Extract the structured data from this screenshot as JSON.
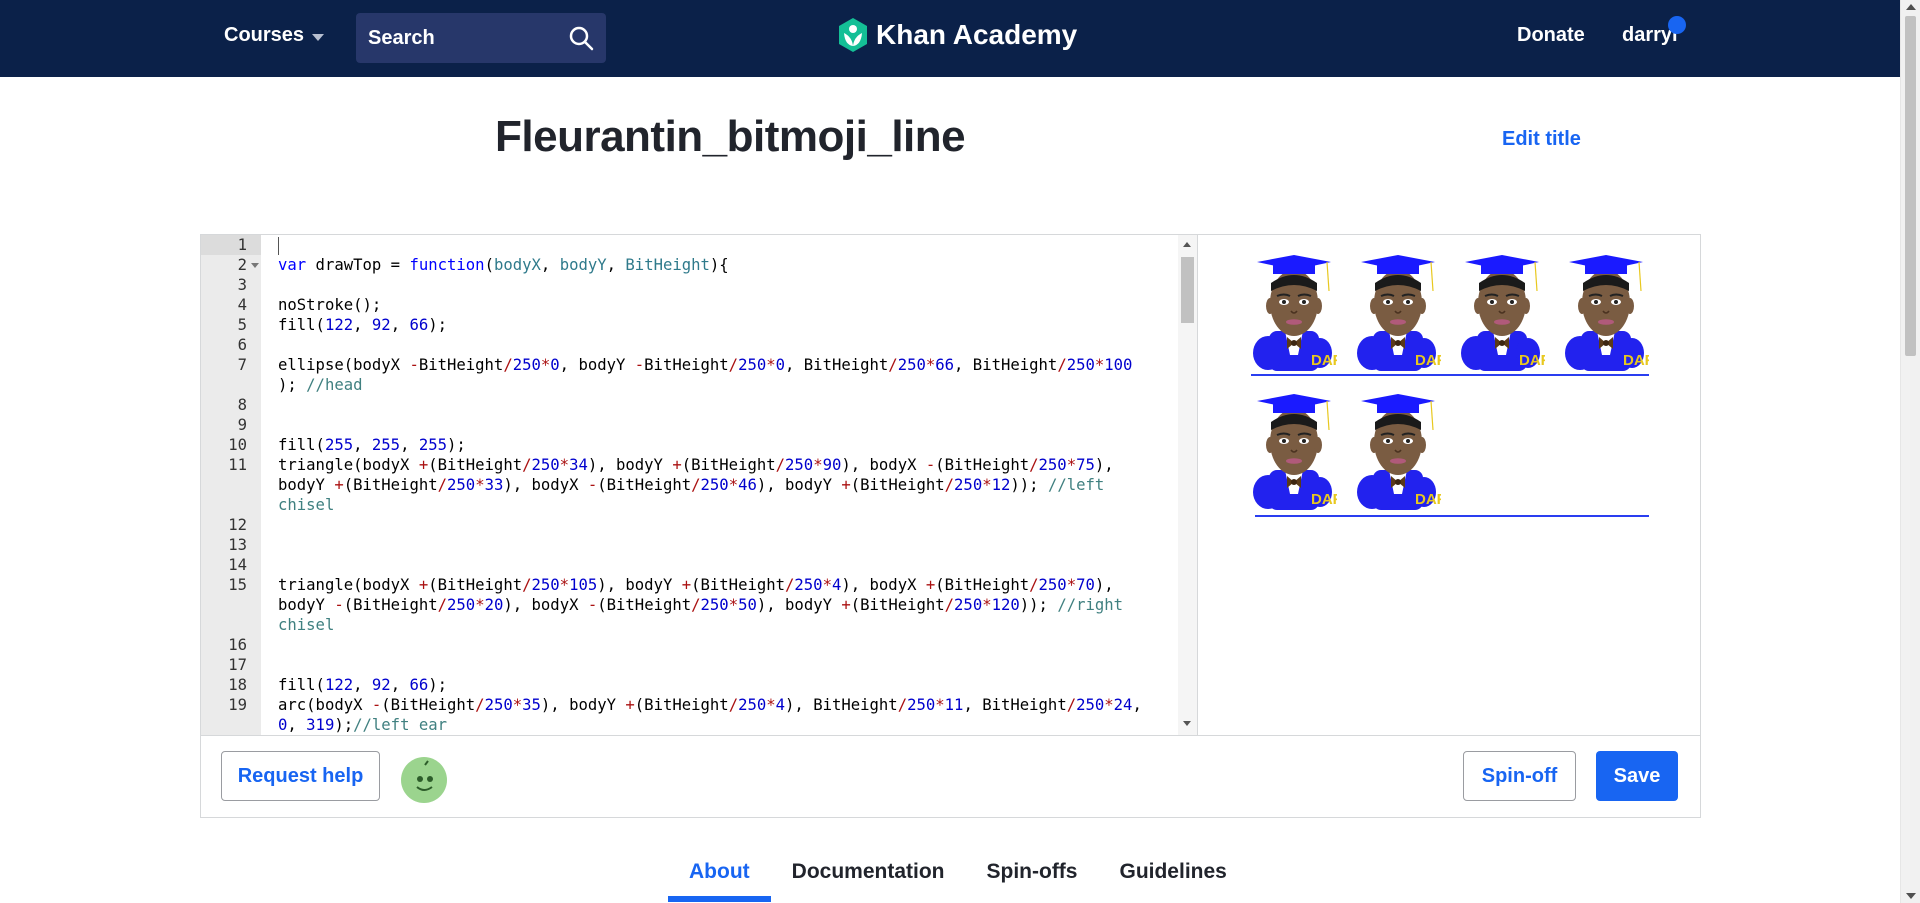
{
  "header": {
    "courses_label": "Courses",
    "search_placeholder": "Search",
    "logo_text": "Khan Academy",
    "donate_label": "Donate",
    "user_name": "darryl",
    "background_color": "#0b2149"
  },
  "page": {
    "title": "Fleurantin_bitmoji_line",
    "edit_title_label": "Edit title"
  },
  "editor": {
    "active_line": 1,
    "lines": [
      {
        "num": "1",
        "html": "<span class=\"cursor\"></span>"
      },
      {
        "num": "2",
        "fold": true,
        "html": "<span class=\"k\">var</span> drawTop = <span class=\"k\">function</span>(<span class=\"p\">bodyX</span>, <span class=\"p\">bodyY</span>, <span class=\"p\">BitHeight</span>){"
      },
      {
        "num": "3",
        "html": ""
      },
      {
        "num": "4",
        "html": "noStroke();"
      },
      {
        "num": "5",
        "html": "fill(<span class=\"n\">122</span>, <span class=\"n\">92</span>, <span class=\"n\">66</span>);"
      },
      {
        "num": "6",
        "html": ""
      },
      {
        "num": "7",
        "html": "ellipse(bodyX <span class=\"o\">-</span>BitHeight<span class=\"o\">/</span><span class=\"n\">250</span><span class=\"o\">*</span><span class=\"n\">0</span>, bodyY <span class=\"o\">-</span>BitHeight<span class=\"o\">/</span><span class=\"n\">250</span><span class=\"o\">*</span><span class=\"n\">0</span>, BitHeight<span class=\"o\">/</span><span class=\"n\">250</span><span class=\"o\">*</span><span class=\"n\">66</span>, BitHeight<span class=\"o\">/</span><span class=\"n\">250</span><span class=\"o\">*</span><span class=\"n\">100</span>\n); <span class=\"c\">//head</span>"
      },
      {
        "num": "8",
        "html": ""
      },
      {
        "num": "9",
        "html": ""
      },
      {
        "num": "10",
        "html": "fill(<span class=\"n\">255</span>, <span class=\"n\">255</span>, <span class=\"n\">255</span>);"
      },
      {
        "num": "11",
        "html": "triangle(bodyX <span class=\"o\">+</span>(BitHeight<span class=\"o\">/</span><span class=\"n\">250</span><span class=\"o\">*</span><span class=\"n\">34</span>), bodyY <span class=\"o\">+</span>(BitHeight<span class=\"o\">/</span><span class=\"n\">250</span><span class=\"o\">*</span><span class=\"n\">90</span>), bodyX <span class=\"o\">-</span>(BitHeight<span class=\"o\">/</span><span class=\"n\">250</span><span class=\"o\">*</span><span class=\"n\">75</span>),\nbodyY <span class=\"o\">+</span>(BitHeight<span class=\"o\">/</span><span class=\"n\">250</span><span class=\"o\">*</span><span class=\"n\">33</span>), bodyX <span class=\"o\">-</span>(BitHeight<span class=\"o\">/</span><span class=\"n\">250</span><span class=\"o\">*</span><span class=\"n\">46</span>), bodyY <span class=\"o\">+</span>(BitHeight<span class=\"o\">/</span><span class=\"n\">250</span><span class=\"o\">*</span><span class=\"n\">12</span>)); <span class=\"c\">//left\nchisel</span>"
      },
      {
        "num": "12",
        "html": ""
      },
      {
        "num": "13",
        "html": ""
      },
      {
        "num": "14",
        "html": ""
      },
      {
        "num": "15",
        "html": "triangle(bodyX <span class=\"o\">+</span>(BitHeight<span class=\"o\">/</span><span class=\"n\">250</span><span class=\"o\">*</span><span class=\"n\">105</span>), bodyY <span class=\"o\">+</span>(BitHeight<span class=\"o\">/</span><span class=\"n\">250</span><span class=\"o\">*</span><span class=\"n\">4</span>), bodyX <span class=\"o\">+</span>(BitHeight<span class=\"o\">/</span><span class=\"n\">250</span><span class=\"o\">*</span><span class=\"n\">70</span>),\nbodyY <span class=\"o\">-</span>(BitHeight<span class=\"o\">/</span><span class=\"n\">250</span><span class=\"o\">*</span><span class=\"n\">20</span>), bodyX <span class=\"o\">-</span>(BitHeight<span class=\"o\">/</span><span class=\"n\">250</span><span class=\"o\">*</span><span class=\"n\">50</span>), bodyY <span class=\"o\">+</span>(BitHeight<span class=\"o\">/</span><span class=\"n\">250</span><span class=\"o\">*</span><span class=\"n\">120</span>)); <span class=\"c\">//right\nchisel</span>"
      },
      {
        "num": "16",
        "html": ""
      },
      {
        "num": "17",
        "html": ""
      },
      {
        "num": "18",
        "html": "fill(<span class=\"n\">122</span>, <span class=\"n\">92</span>, <span class=\"n\">66</span>);"
      },
      {
        "num": "19",
        "html": "arc(bodyX <span class=\"o\">-</span>(BitHeight<span class=\"o\">/</span><span class=\"n\">250</span><span class=\"o\">*</span><span class=\"n\">35</span>), bodyY <span class=\"o\">+</span>(BitHeight<span class=\"o\">/</span><span class=\"n\">250</span><span class=\"o\">*</span><span class=\"n\">4</span>), BitHeight<span class=\"o\">/</span><span class=\"n\">250</span><span class=\"o\">*</span><span class=\"n\">11</span>, BitHeight<span class=\"o\">/</span><span class=\"n\">250</span><span class=\"o\">*</span><span class=\"n\">24</span>,\n<span class=\"n\">0</span>, <span class=\"n\">319</span>);<span class=\"c\">//left ear</span>"
      }
    ]
  },
  "output": {
    "badge_text": "DAF",
    "figure_count": 6,
    "colors": {
      "skin": "#7a5c42",
      "cap": "#1a1aff",
      "body": "#2222ee",
      "badge": "#e8c81e"
    }
  },
  "toolbar": {
    "request_help_label": "Request help",
    "spinoff_label": "Spin-off",
    "save_label": "Save"
  },
  "tabs": [
    {
      "label": "About",
      "active": true
    },
    {
      "label": "Documentation",
      "active": false
    },
    {
      "label": "Spin-offs",
      "active": false
    },
    {
      "label": "Guidelines",
      "active": false
    }
  ]
}
